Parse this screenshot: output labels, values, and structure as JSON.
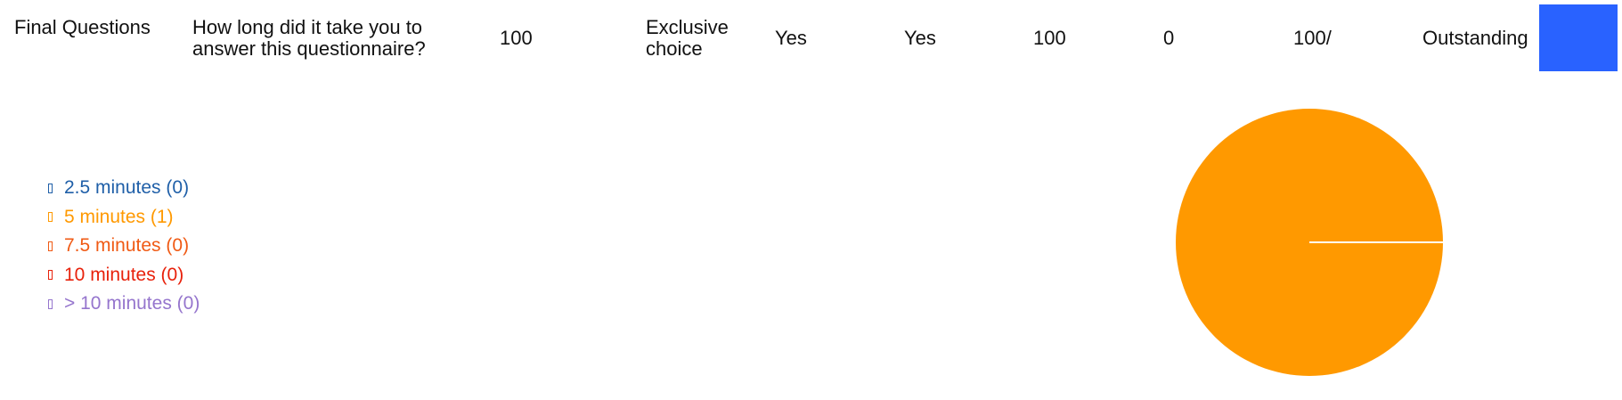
{
  "row": {
    "section": "Final Questions",
    "question_line1": "How long did it take you to",
    "question_line2": "answer this questionnaire?",
    "score": "100",
    "type_line1": "Exclusive",
    "type_line2": "choice",
    "answered": "Yes",
    "required": "Yes",
    "max_points": "100",
    "min_points": "0",
    "result": "100/",
    "rating": "Outstanding",
    "rating_color": "#2962ff"
  },
  "chart_data": {
    "type": "pie",
    "slices": [
      {
        "label": "2.5 minutes (0)",
        "value": 0,
        "color": "#1f5fa8"
      },
      {
        "label": "5 minutes (1)",
        "value": 1,
        "color": "#ff9900"
      },
      {
        "label": "7.5 minutes (0)",
        "value": 0,
        "color": "#f05a14"
      },
      {
        "label": "10 minutes (0)",
        "value": 0,
        "color": "#e8210b"
      },
      {
        "label": "> 10 minutes (0)",
        "value": 0,
        "color": "#9575cd"
      }
    ],
    "legend_position": "left"
  }
}
